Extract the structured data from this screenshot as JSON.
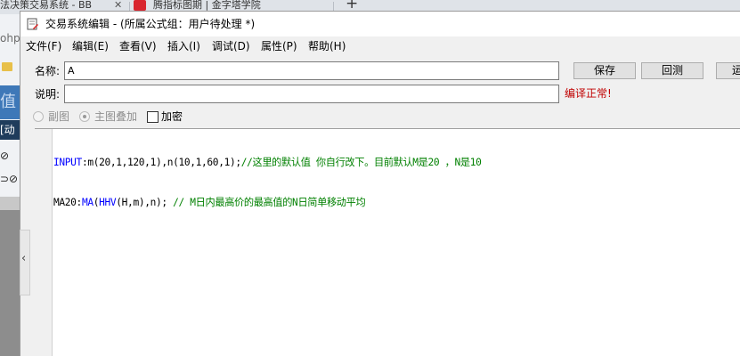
{
  "background_browser": {
    "tab1_label": "法决策交易系统 - BB",
    "tab2_label": "腾指标图期 | 金字塔学院",
    "newtab_symbol": "+",
    "close_symbol": "✕",
    "left_text_php": "ohp",
    "left_text_value": "值",
    "left_text_dong": "[动",
    "collapse_arrow": "‹"
  },
  "window": {
    "title": "交易系统编辑 - (所属公式组：用户待处理 *)"
  },
  "menu": [
    "文件(F)",
    "编辑(E)",
    "查看(V)",
    "插入(I)",
    "调试(D)",
    "属性(P)",
    "帮助(H)"
  ],
  "form": {
    "name_label": "名称:",
    "name_value": "A",
    "desc_label": "说明:",
    "desc_value": "",
    "save_button": "保存",
    "test_button": "回测",
    "run_button": "运",
    "compile_status": "编译正常!",
    "radio_sub": "副图",
    "radio_main": "主图叠加",
    "checkbox_encrypt": "加密"
  },
  "code": {
    "line1_kw": "INPUT",
    "line1_text": ":m(20,1,120,1),n(10,1,60,1);",
    "line1_comment": "//这里的默认值 你自行改下。目前默认M是20 ，N是10",
    "line2_text1": "MA20:",
    "line2_kw1": "MA",
    "line2_text2": "(",
    "line2_kw2": "HHV",
    "line2_text3": "(H,m),n); ",
    "line2_comment": "// M日内最高价的最高值的N日简单移动平均"
  },
  "colors": {
    "keyword": "#0000ff",
    "comment": "#008000",
    "status": "#c00000"
  }
}
